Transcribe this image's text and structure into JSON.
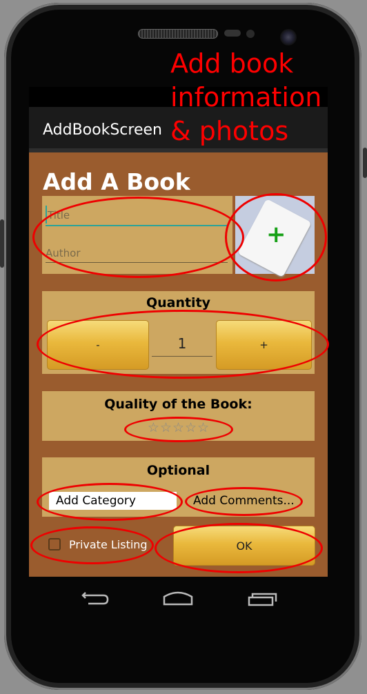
{
  "annotation": {
    "line1": "Add book",
    "line2": "information",
    "line3": "& photos",
    "color": "#ff0000"
  },
  "app": {
    "title_bar": "AddBookScreen",
    "page_title": "Add A Book"
  },
  "book_form": {
    "title_placeholder": "Title",
    "author_placeholder": "Author",
    "add_photo_icon": "plus-icon"
  },
  "quantity": {
    "label": "Quantity",
    "decrement_label": "-",
    "value": "1",
    "increment_label": "+"
  },
  "quality": {
    "label": "Quality of the Book:",
    "rating": 0,
    "max_rating": 5,
    "stars": "☆☆☆☆☆"
  },
  "optional": {
    "label": "Optional",
    "category": "Add Category",
    "comments": "Add Comments..."
  },
  "footer": {
    "private_label": "Private Listing",
    "private_checked": false,
    "ok_label": "OK"
  },
  "nav": {
    "icons": [
      "back-icon",
      "home-icon",
      "recent-apps-icon"
    ]
  },
  "colors": {
    "background": "#9a5c2e",
    "panel": "#cda761",
    "button": "#e9b83c"
  }
}
